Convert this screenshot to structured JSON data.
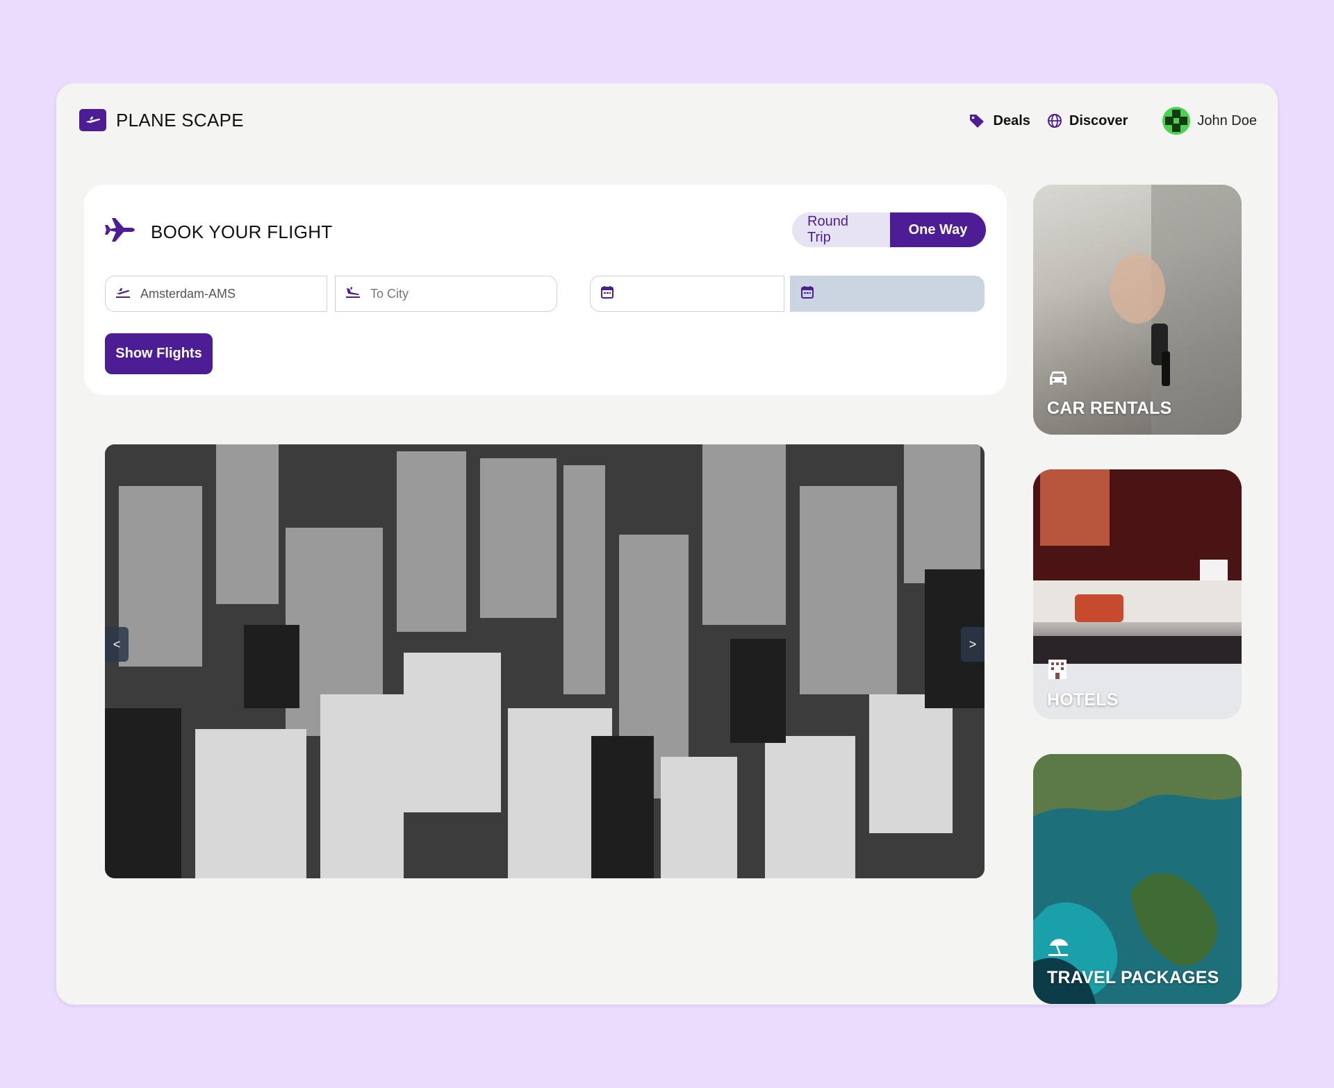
{
  "header": {
    "brand_name": "PLANE SCAPE",
    "nav": {
      "deals_label": "Deals",
      "discover_label": "Discover"
    },
    "user_name": "John Doe"
  },
  "booking": {
    "title": "BOOK YOUR FLIGHT",
    "trip_types": {
      "round_trip_label": "Round Trip",
      "one_way_label": "One Way",
      "selected": "One Way"
    },
    "from_value": "Amsterdam-AMS",
    "to_placeholder": "To City",
    "depart_value": "",
    "return_value": "",
    "show_flights_label": "Show Flights"
  },
  "carousel": {
    "prev_label": "<",
    "next_label": ">"
  },
  "side_cards": [
    {
      "label": "CAR RENTALS",
      "icon": "car-icon"
    },
    {
      "label": "HOTELS",
      "icon": "hotel-icon"
    },
    {
      "label": "TRAVEL PACKAGES",
      "icon": "umbrella-beach-icon"
    }
  ],
  "colors": {
    "accent": "#4c1d95",
    "page_background": "#ebdcfe",
    "app_background": "#f4f4f2",
    "disabled_input": "#cbd5e1"
  }
}
